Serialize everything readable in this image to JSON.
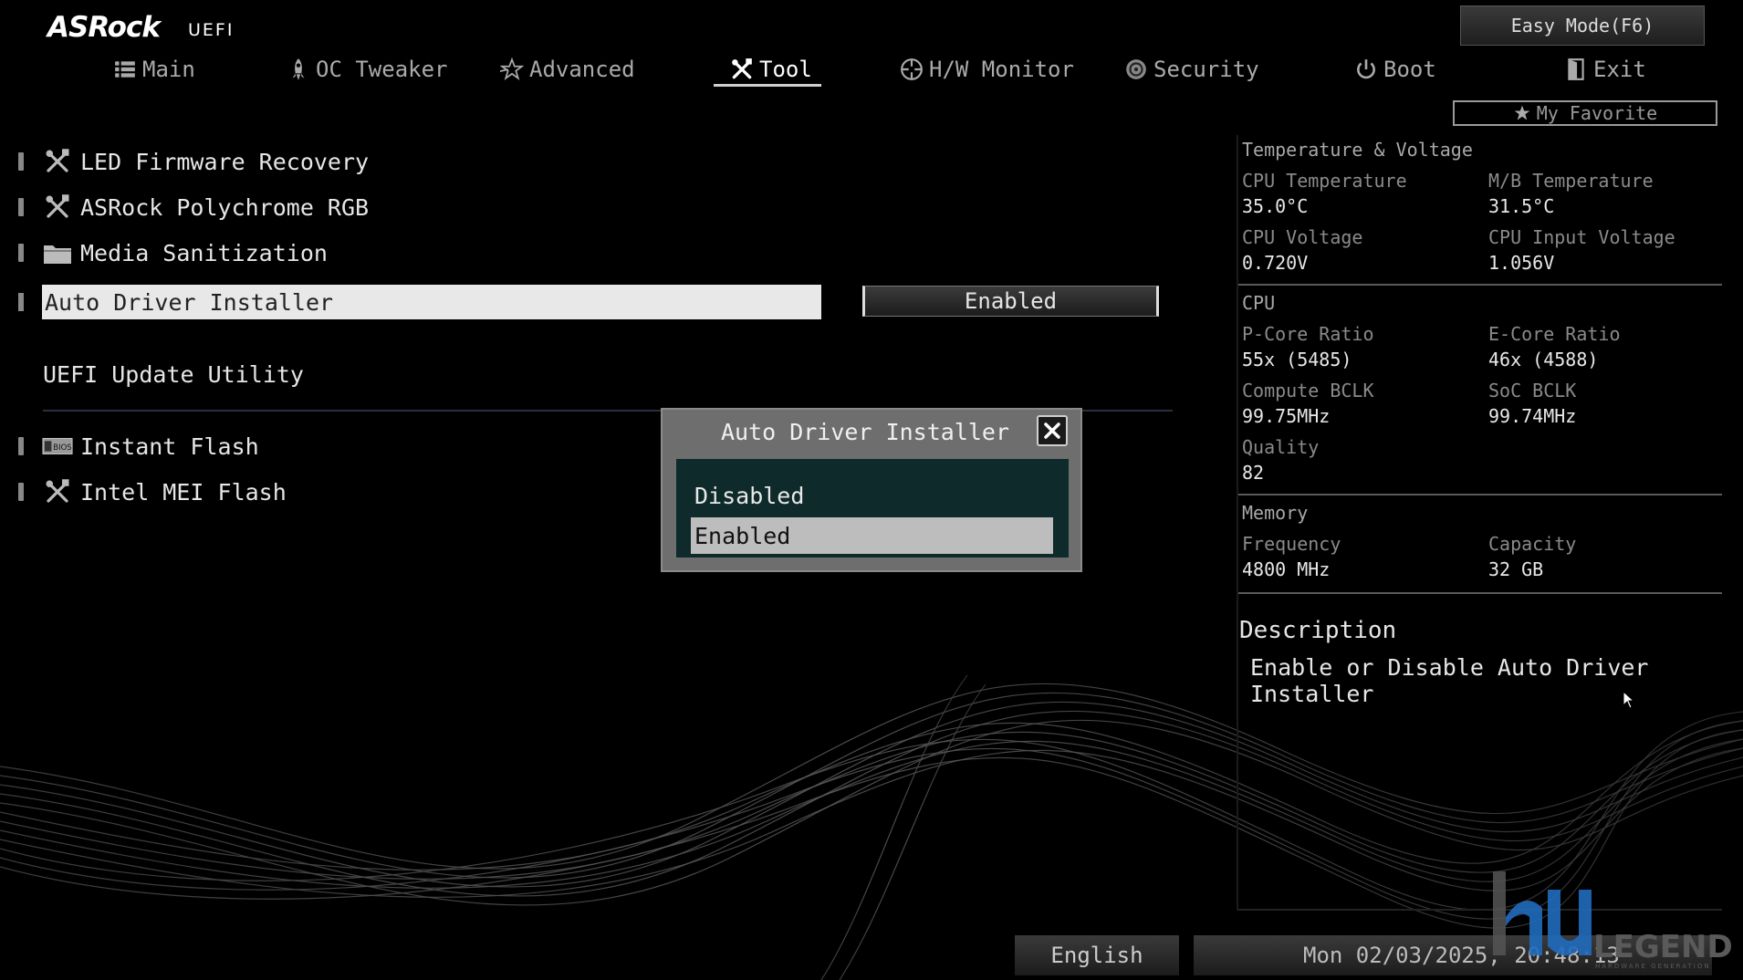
{
  "brand": {
    "logo": "ASRock",
    "suffix": "UEFI"
  },
  "easy_mode": "Easy Mode(F6)",
  "tabs": [
    {
      "label": "Main",
      "icon": "list-icon"
    },
    {
      "label": "OC Tweaker",
      "icon": "rocket-icon"
    },
    {
      "label": "Advanced",
      "icon": "star-icon"
    },
    {
      "label": "Tool",
      "icon": "tools-icon",
      "active": true
    },
    {
      "label": "H/W Monitor",
      "icon": "crosshair-icon"
    },
    {
      "label": "Security",
      "icon": "shield-icon"
    },
    {
      "label": "Boot",
      "icon": "power-icon"
    },
    {
      "label": "Exit",
      "icon": "exit-icon"
    }
  ],
  "my_favorite": "My Favorite",
  "menu": {
    "items": [
      {
        "label": "LED Firmware Recovery",
        "icon": "tools-icon"
      },
      {
        "label": "ASRock Polychrome RGB",
        "icon": "tools-icon"
      },
      {
        "label": "Media Sanitization",
        "icon": "folder-icon"
      }
    ],
    "selected": {
      "label": "Auto Driver Installer",
      "value": "Enabled"
    },
    "section_title": "UEFI Update Utility",
    "section_items": [
      {
        "label": "Instant Flash",
        "icon": "bios-icon"
      },
      {
        "label": "Intel MEI Flash",
        "icon": "tools-icon"
      }
    ]
  },
  "popup": {
    "title": "Auto Driver Installer",
    "options": [
      "Disabled",
      "Enabled"
    ],
    "selected": "Enabled"
  },
  "monitor": {
    "temp_voltage": {
      "heading": "Temperature & Voltage",
      "cpu_temp_label": "CPU Temperature",
      "cpu_temp": "35.0°C",
      "mb_temp_label": "M/B Temperature",
      "mb_temp": "31.5°C",
      "cpu_volt_label": "CPU Voltage",
      "cpu_volt": "0.720V",
      "cpu_input_label": "CPU Input Voltage",
      "cpu_input": "1.056V"
    },
    "cpu": {
      "heading": "CPU",
      "pcore_label": "P-Core Ratio",
      "pcore": "55x (5485)",
      "ecore_label": "E-Core Ratio",
      "ecore": "46x (4588)",
      "bclk_label": "Compute BCLK",
      "bclk": "99.75MHz",
      "soc_label": "SoC BCLK",
      "soc": "99.74MHz",
      "quality_label": "Quality",
      "quality": "82"
    },
    "memory": {
      "heading": "Memory",
      "freq_label": "Frequency",
      "freq": "4800 MHz",
      "cap_label": "Capacity",
      "cap": "32 GB"
    }
  },
  "description": {
    "heading": "Description",
    "text": "Enable or Disable Auto Driver Installer"
  },
  "footer": {
    "language": "English",
    "datetime": "Mon 02/03/2025, 20:48:13"
  },
  "watermark": {
    "letters": "lku",
    "word": "LEGEND",
    "tagline": "HARDWARE GENERATION"
  },
  "colors": {
    "popup_list_bg": "#0e2a2a",
    "highlight": "#e8e8e8",
    "selected_option": "#bdbdbd"
  }
}
